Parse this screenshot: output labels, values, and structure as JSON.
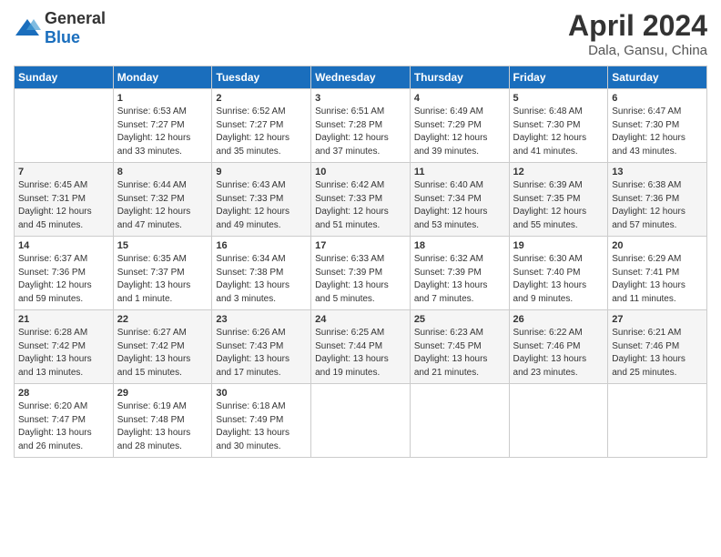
{
  "header": {
    "logo": {
      "general": "General",
      "blue": "Blue"
    },
    "title": "April 2024",
    "subtitle": "Dala, Gansu, China"
  },
  "calendar": {
    "days_of_week": [
      "Sunday",
      "Monday",
      "Tuesday",
      "Wednesday",
      "Thursday",
      "Friday",
      "Saturday"
    ],
    "weeks": [
      [
        {
          "day": "",
          "content": ""
        },
        {
          "day": "1",
          "content": "Sunrise: 6:53 AM\nSunset: 7:27 PM\nDaylight: 12 hours\nand 33 minutes."
        },
        {
          "day": "2",
          "content": "Sunrise: 6:52 AM\nSunset: 7:27 PM\nDaylight: 12 hours\nand 35 minutes."
        },
        {
          "day": "3",
          "content": "Sunrise: 6:51 AM\nSunset: 7:28 PM\nDaylight: 12 hours\nand 37 minutes."
        },
        {
          "day": "4",
          "content": "Sunrise: 6:49 AM\nSunset: 7:29 PM\nDaylight: 12 hours\nand 39 minutes."
        },
        {
          "day": "5",
          "content": "Sunrise: 6:48 AM\nSunset: 7:30 PM\nDaylight: 12 hours\nand 41 minutes."
        },
        {
          "day": "6",
          "content": "Sunrise: 6:47 AM\nSunset: 7:30 PM\nDaylight: 12 hours\nand 43 minutes."
        }
      ],
      [
        {
          "day": "7",
          "content": "Sunrise: 6:45 AM\nSunset: 7:31 PM\nDaylight: 12 hours\nand 45 minutes."
        },
        {
          "day": "8",
          "content": "Sunrise: 6:44 AM\nSunset: 7:32 PM\nDaylight: 12 hours\nand 47 minutes."
        },
        {
          "day": "9",
          "content": "Sunrise: 6:43 AM\nSunset: 7:33 PM\nDaylight: 12 hours\nand 49 minutes."
        },
        {
          "day": "10",
          "content": "Sunrise: 6:42 AM\nSunset: 7:33 PM\nDaylight: 12 hours\nand 51 minutes."
        },
        {
          "day": "11",
          "content": "Sunrise: 6:40 AM\nSunset: 7:34 PM\nDaylight: 12 hours\nand 53 minutes."
        },
        {
          "day": "12",
          "content": "Sunrise: 6:39 AM\nSunset: 7:35 PM\nDaylight: 12 hours\nand 55 minutes."
        },
        {
          "day": "13",
          "content": "Sunrise: 6:38 AM\nSunset: 7:36 PM\nDaylight: 12 hours\nand 57 minutes."
        }
      ],
      [
        {
          "day": "14",
          "content": "Sunrise: 6:37 AM\nSunset: 7:36 PM\nDaylight: 12 hours\nand 59 minutes."
        },
        {
          "day": "15",
          "content": "Sunrise: 6:35 AM\nSunset: 7:37 PM\nDaylight: 13 hours\nand 1 minute."
        },
        {
          "day": "16",
          "content": "Sunrise: 6:34 AM\nSunset: 7:38 PM\nDaylight: 13 hours\nand 3 minutes."
        },
        {
          "day": "17",
          "content": "Sunrise: 6:33 AM\nSunset: 7:39 PM\nDaylight: 13 hours\nand 5 minutes."
        },
        {
          "day": "18",
          "content": "Sunrise: 6:32 AM\nSunset: 7:39 PM\nDaylight: 13 hours\nand 7 minutes."
        },
        {
          "day": "19",
          "content": "Sunrise: 6:30 AM\nSunset: 7:40 PM\nDaylight: 13 hours\nand 9 minutes."
        },
        {
          "day": "20",
          "content": "Sunrise: 6:29 AM\nSunset: 7:41 PM\nDaylight: 13 hours\nand 11 minutes."
        }
      ],
      [
        {
          "day": "21",
          "content": "Sunrise: 6:28 AM\nSunset: 7:42 PM\nDaylight: 13 hours\nand 13 minutes."
        },
        {
          "day": "22",
          "content": "Sunrise: 6:27 AM\nSunset: 7:42 PM\nDaylight: 13 hours\nand 15 minutes."
        },
        {
          "day": "23",
          "content": "Sunrise: 6:26 AM\nSunset: 7:43 PM\nDaylight: 13 hours\nand 17 minutes."
        },
        {
          "day": "24",
          "content": "Sunrise: 6:25 AM\nSunset: 7:44 PM\nDaylight: 13 hours\nand 19 minutes."
        },
        {
          "day": "25",
          "content": "Sunrise: 6:23 AM\nSunset: 7:45 PM\nDaylight: 13 hours\nand 21 minutes."
        },
        {
          "day": "26",
          "content": "Sunrise: 6:22 AM\nSunset: 7:46 PM\nDaylight: 13 hours\nand 23 minutes."
        },
        {
          "day": "27",
          "content": "Sunrise: 6:21 AM\nSunset: 7:46 PM\nDaylight: 13 hours\nand 25 minutes."
        }
      ],
      [
        {
          "day": "28",
          "content": "Sunrise: 6:20 AM\nSunset: 7:47 PM\nDaylight: 13 hours\nand 26 minutes."
        },
        {
          "day": "29",
          "content": "Sunrise: 6:19 AM\nSunset: 7:48 PM\nDaylight: 13 hours\nand 28 minutes."
        },
        {
          "day": "30",
          "content": "Sunrise: 6:18 AM\nSunset: 7:49 PM\nDaylight: 13 hours\nand 30 minutes."
        },
        {
          "day": "",
          "content": ""
        },
        {
          "day": "",
          "content": ""
        },
        {
          "day": "",
          "content": ""
        },
        {
          "day": "",
          "content": ""
        }
      ]
    ]
  }
}
